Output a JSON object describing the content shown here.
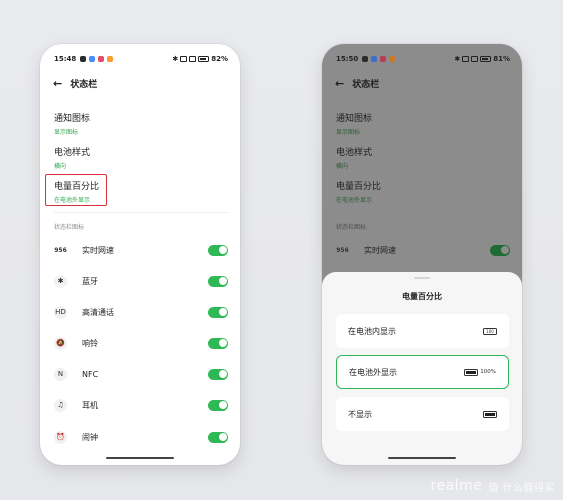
{
  "left_phone": {
    "status": {
      "time": "15:48",
      "battery": "82%"
    },
    "header": {
      "title": "状态栏"
    },
    "settings": [
      {
        "title": "通知图标",
        "value": "显示图标"
      },
      {
        "title": "电池样式",
        "value": "横向"
      },
      {
        "title": "电量百分比",
        "value": "在电池外显示"
      }
    ],
    "section_label": "状态栏图标",
    "rows": [
      {
        "icon_text": "956",
        "label": "实时网速",
        "enabled": true
      },
      {
        "icon_text": "✱",
        "label": "蓝牙",
        "enabled": true
      },
      {
        "icon_text": "HD",
        "label": "高清通话",
        "enabled": true
      },
      {
        "icon_text": "🔕",
        "label": "响铃",
        "enabled": true
      },
      {
        "icon_text": "N",
        "label": "NFC",
        "enabled": true
      },
      {
        "icon_text": "♫",
        "label": "耳机",
        "enabled": true
      },
      {
        "icon_text": "⏰",
        "label": "闹钟",
        "enabled": true
      }
    ]
  },
  "right_phone": {
    "status": {
      "time": "15:50",
      "battery": "81%"
    },
    "header": {
      "title": "状态栏"
    },
    "settings": [
      {
        "title": "通知图标",
        "value": "显示图标"
      },
      {
        "title": "电池样式",
        "value": "横向"
      },
      {
        "title": "电量百分比",
        "value": "在电池外显示"
      }
    ],
    "section_label": "状态栏图标",
    "row": {
      "icon_text": "956",
      "label": "实时网速"
    },
    "sheet": {
      "title": "电量百分比",
      "options": [
        {
          "label": "在电池内显示",
          "indicator": "100",
          "selected": false
        },
        {
          "label": "在电池外显示",
          "indicator": "100%",
          "selected": true
        },
        {
          "label": "不显示",
          "indicator": "",
          "selected": false
        }
      ]
    }
  },
  "watermark": {
    "brand": "realme",
    "site": "值 什么值得买"
  },
  "colors": {
    "accent_green": "#2fb856",
    "highlight_red": "#d9303a",
    "subtext_green": "#2fa84f"
  }
}
